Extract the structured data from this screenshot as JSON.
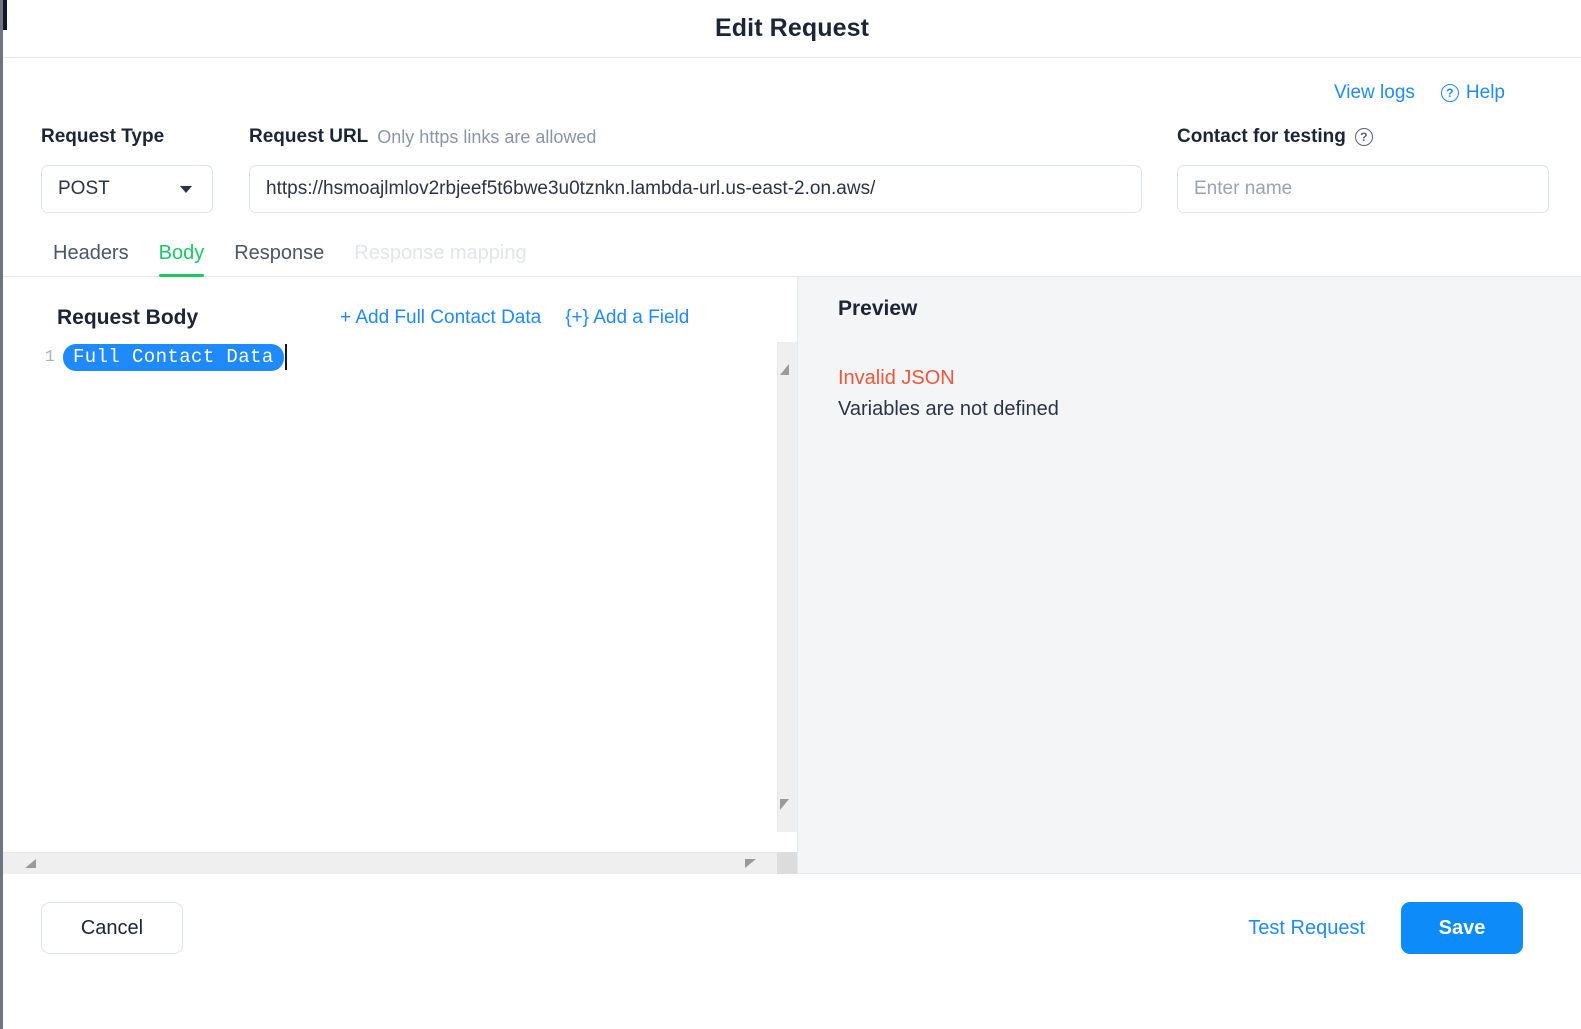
{
  "window": {
    "title": "Edit Request"
  },
  "top_links": {
    "view_logs": "View logs",
    "help": "Help",
    "help_icon": "question-circle-icon"
  },
  "form": {
    "request_type": {
      "label": "Request Type",
      "value": "POST",
      "caret_icon": "chevron-down-icon"
    },
    "request_url": {
      "label": "Request URL",
      "hint": "Only https links are allowed",
      "value": "https://hsmoajlmlov2rbjeef5t6bwe3u0tznkn.lambda-url.us-east-2.on.aws/"
    },
    "contact_for_testing": {
      "label": "Contact for testing",
      "help_icon": "question-circle-icon",
      "placeholder": "Enter name",
      "value": ""
    }
  },
  "tabs": [
    {
      "label": "Headers",
      "state": "normal"
    },
    {
      "label": "Body",
      "state": "active"
    },
    {
      "label": "Response",
      "state": "normal"
    },
    {
      "label": "Response mapping",
      "state": "disabled"
    }
  ],
  "editor": {
    "title": "Request Body",
    "actions": [
      {
        "label": "+ Add Full Contact Data"
      },
      {
        "label": "{+} Add a Field"
      }
    ],
    "lines": [
      {
        "number": "1",
        "token": "Full Contact Data"
      }
    ]
  },
  "preview": {
    "title": "Preview",
    "error": "Invalid JSON",
    "message": "Variables are not defined"
  },
  "footer": {
    "cancel": "Cancel",
    "test_request": "Test Request",
    "save": "Save"
  },
  "colors": {
    "accent_blue": "#1f8afc",
    "save_blue": "#0d8bf9",
    "active_tab_green": "#18c964",
    "error_red": "#f1553b",
    "preview_bg": "#f4f5f7",
    "text_dark": "#1c2536",
    "muted": "#8b95a8"
  }
}
